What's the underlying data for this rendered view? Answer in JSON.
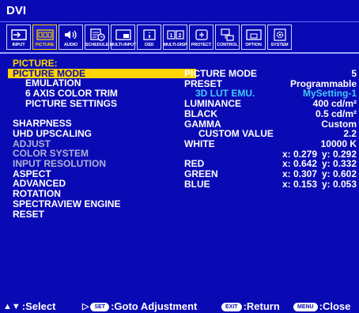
{
  "window": {
    "title": "DVI"
  },
  "tabs": [
    {
      "label": "INPUT",
      "icon": "input-icon",
      "active": false
    },
    {
      "label": "PICTURE",
      "icon": "picture-icon",
      "active": true
    },
    {
      "label": "AUDIO",
      "icon": "audio-icon",
      "active": false
    },
    {
      "label": "SCHEDULE",
      "icon": "schedule-icon",
      "active": false
    },
    {
      "label": "MULTI-INPUT",
      "icon": "multi-input-icon",
      "active": false
    },
    {
      "label": "OSD",
      "icon": "osd-icon",
      "active": false
    },
    {
      "label": "MULTI-DISP",
      "icon": "multi-disp-icon",
      "active": false
    },
    {
      "label": "PROTECT",
      "icon": "protect-icon",
      "active": false
    },
    {
      "label": "CONTROL",
      "icon": "control-icon",
      "active": false
    },
    {
      "label": "OPTION",
      "icon": "option-icon",
      "active": false
    },
    {
      "label": "SYSTEM",
      "icon": "system-icon",
      "active": false
    }
  ],
  "menu": {
    "category": "PICTURE:",
    "items": [
      {
        "label": "PICTURE MODE",
        "state": "selected"
      },
      {
        "label": "EMULATION",
        "state": "sub"
      },
      {
        "label": "6 AXIS COLOR TRIM",
        "state": "sub"
      },
      {
        "label": "PICTURE SETTINGS",
        "state": "sub"
      },
      {
        "label": "SHARPNESS",
        "state": "normal"
      },
      {
        "label": "UHD UPSCALING",
        "state": "normal"
      },
      {
        "label": "ADJUST",
        "state": "disabled"
      },
      {
        "label": "COLOR SYSTEM",
        "state": "disabled"
      },
      {
        "label": "INPUT RESOLUTION",
        "state": "disabled"
      },
      {
        "label": "ASPECT",
        "state": "normal"
      },
      {
        "label": "ADVANCED",
        "state": "normal"
      },
      {
        "label": "ROTATION",
        "state": "normal"
      },
      {
        "label": "SPECTRAVIEW ENGINE",
        "state": "normal"
      },
      {
        "label": "RESET",
        "state": "normal"
      }
    ]
  },
  "detail": {
    "picture_mode": {
      "label": "PICTURE MODE",
      "value": "5"
    },
    "preset": {
      "label": "PRESET",
      "value": "Programmable"
    },
    "lut": {
      "label": "3D LUT EMU.",
      "value": "MySetting-1"
    },
    "luminance": {
      "label": "LUMINANCE",
      "value": "400 cd/m²"
    },
    "black": {
      "label": "BLACK",
      "value": "0.5 cd/m²"
    },
    "gamma": {
      "label": "GAMMA",
      "value": "Custom"
    },
    "custom_value": {
      "label": "CUSTOM VALUE",
      "value": "2.2"
    },
    "white": {
      "label": "WHITE",
      "value": "10000 K",
      "x": "x: 0.279",
      "y": "y: 0.292"
    },
    "red": {
      "label": "RED",
      "x": "x: 0.642",
      "y": "y: 0.332"
    },
    "green": {
      "label": "GREEN",
      "x": "x: 0.307",
      "y": "y: 0.602"
    },
    "blue": {
      "label": "BLUE",
      "x": "x: 0.153",
      "y": "y: 0.053"
    }
  },
  "footer": {
    "select": ":Select",
    "set_key": "SET",
    "goto": ":Goto Adjustment",
    "exit_key": "EXIT",
    "return": ":Return",
    "menu_key": "MENU",
    "close": ":Close"
  },
  "colors": {
    "background": "#0a0ab4",
    "highlight": "#ffd400",
    "accent_value": "#3fc7ff",
    "disabled": "#b0b3d8"
  }
}
